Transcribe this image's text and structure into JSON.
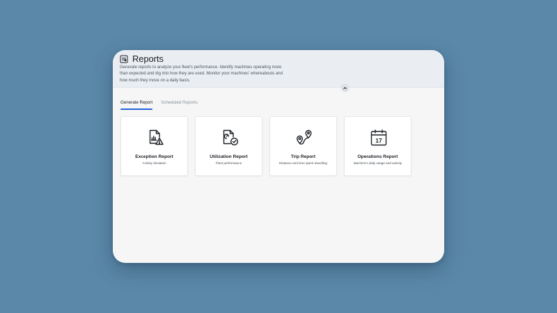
{
  "header": {
    "title": "Reports",
    "description": "Generate reports to analyze your fleet's performance. Identify machines operating more than expected and dig into how they are used. Monitor your machines' whereabouts and how much they move on a daily basis.",
    "title_icon": "report-icon",
    "collapse_icon": "chevron-up-icon"
  },
  "tabs": [
    {
      "label": "Generate Report",
      "active": true
    },
    {
      "label": "Scheduled Reports",
      "active": false
    }
  ],
  "cards": [
    {
      "title": "Exception Report",
      "subtitle": "Activity deviation",
      "icon": "exception-report-icon"
    },
    {
      "title": "Utilization Report",
      "subtitle": "Fleet performance",
      "icon": "utilization-report-icon"
    },
    {
      "title": "Trip Report",
      "subtitle": "Distance and time spent travelling",
      "icon": "trip-route-icon"
    },
    {
      "title": "Operations Report",
      "subtitle": "Machine's daily usage and activity",
      "icon": "calendar-icon",
      "icon_text": "17"
    }
  ],
  "colors": {
    "background": "#5b88a8",
    "accent": "#2463d8",
    "header_bg": "#eaeef2",
    "panel_bg": "#f6f6f7"
  }
}
